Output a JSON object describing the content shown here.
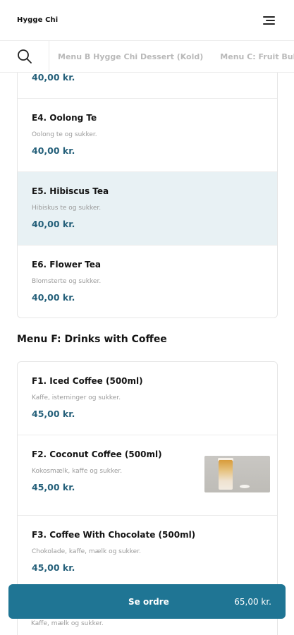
{
  "header": {
    "brand": "Hygge Chi"
  },
  "categories": {
    "tabs": [
      "Menu B Hygge Chi Dessert (Kold)",
      "Menu C: Fruit Bubble"
    ]
  },
  "menu_e": {
    "top_price": "40,00 kr.",
    "items": [
      {
        "name": "E4. Oolong Te",
        "desc": "Oolong te og sukker.",
        "price": "40,00 kr."
      },
      {
        "name": "E5. Hibiscus Tea",
        "desc": "Hibiskus te og sukker.",
        "price": "40,00 kr."
      },
      {
        "name": "E6. Flower Tea",
        "desc": "Blomsterte og sukker.",
        "price": "40,00 kr."
      }
    ]
  },
  "menu_f": {
    "title": "Menu F: Drinks with Coffee",
    "items": [
      {
        "name": "F1. Iced Coffee (500ml)",
        "desc": "Kaffe, isterninger og sukker.",
        "price": "45,00 kr."
      },
      {
        "name": "F2. Coconut Coffee (500ml)",
        "desc": "Kokosmælk, kaffe og sukker.",
        "price": "45,00 kr."
      },
      {
        "name": "F3. Coffee With Chocolate (500ml)",
        "desc": "Chokolade, kaffe, mælk og sukker.",
        "price": "45,00 kr."
      }
    ],
    "trailing_desc": "Kaffe, mælk og sukker."
  },
  "order": {
    "label": "Se ordre",
    "total": "65,00 kr."
  }
}
